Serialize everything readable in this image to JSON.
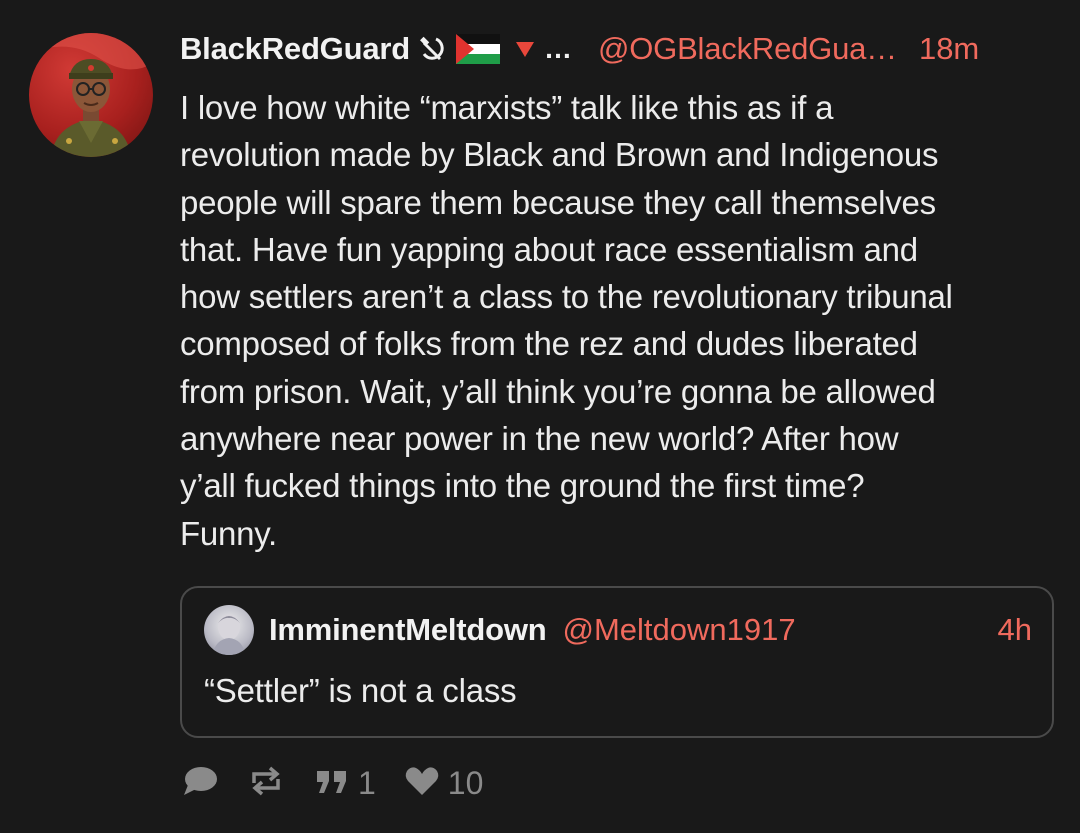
{
  "post": {
    "author": {
      "display_name": "BlackRedGuard",
      "emoji": [
        "hammer-and-sickle",
        "palestine-flag",
        "red-triangle"
      ],
      "truncation": "…",
      "handle": "@OGBlackRedGua…",
      "time": "18m"
    },
    "body_lines": [
      "I love how white “marxists” talk like this as if a",
      "revolution made by Black and Brown and Indigenous",
      "people will spare them because they call themselves",
      "that. Have fun yapping about race essentialism and",
      "how settlers aren’t a class to the revolutionary tribunal",
      "composed of folks from the rez and dudes liberated",
      "from prison. Wait, y’all think you’re gonna be allowed",
      "anywhere near power in the new world? After how",
      "y’all fucked things into the ground the first time?",
      "Funny."
    ],
    "quoted": {
      "display_name": "ImminentMeltdown",
      "handle": "@Meltdown1917",
      "time": "4h",
      "text": "“Settler” is not a class"
    },
    "actions": {
      "reply_icon": "reply-bubble-icon",
      "repost_icon": "repost-icon",
      "quote_icon": "quote-icon",
      "quote_count": "1",
      "like_icon": "heart-icon",
      "like_count": "10"
    },
    "colors": {
      "background": "#191919",
      "accent": "#f06a5d",
      "muted": "#8a8a8a",
      "text": "#ececec"
    }
  }
}
